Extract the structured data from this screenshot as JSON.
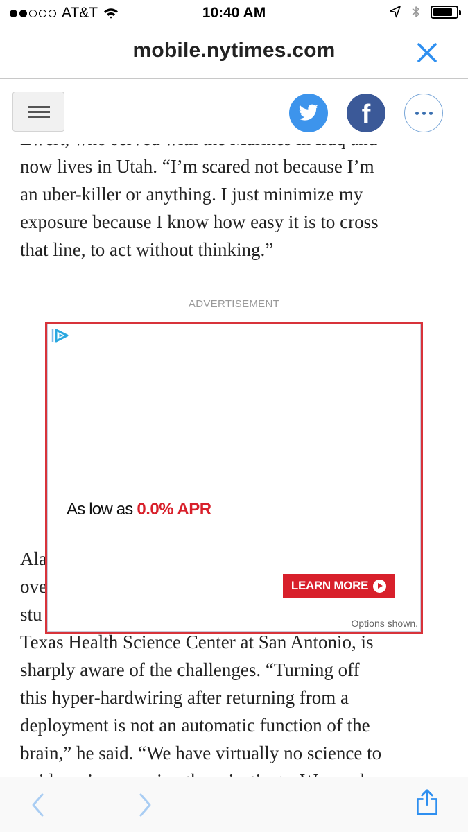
{
  "status_bar": {
    "carrier": "AT&T",
    "time": "10:40 AM",
    "signal_bars_filled": 2,
    "signal_bars_total": 5,
    "battery_level": 0.85
  },
  "browser": {
    "url": "mobile.nytimes.com",
    "close_icon": "close-icon",
    "accent_color": "#2e8ff0"
  },
  "toolbar": {
    "menu_icon": "hamburger-menu-icon",
    "share_buttons": [
      "twitter-icon",
      "facebook-icon",
      "more-icon"
    ],
    "facebook_glyph": "f",
    "twitter_color": "#3d94ec",
    "facebook_color": "#3b5998"
  },
  "article": {
    "top_lines": [
      "Ewert, who served with the Marines in Iraq and",
      "now lives in Utah. “I’m scared not because I’m",
      "an uber-killer or anything. I just minimize my",
      "exposure because I know how easy it is to cross",
      "that line, to act without thinking.”"
    ],
    "bottom_lines": [
      "Ala",
      "ove",
      "stu",
      "Texas Health Science Center at San Antonio, is",
      "sharply aware of the challenges. “Turning off",
      "this hyper-hardwiring after returning from a",
      "deployment is not an automatic function of the",
      "brain,” he said. “We have virtually no science to",
      "guide us in managing these instincts. We need"
    ]
  },
  "advertisement": {
    "label": "ADVERTISEMENT",
    "headline_prefix": "As low as ",
    "headline_highlight": "0.0% APR",
    "button_label": "LEARN MORE",
    "footer": "Options shown.",
    "border_color": "#d8333a",
    "brand_color": "#d8202b",
    "adchoices_icon": "adchoices-icon"
  },
  "bottom_bar": {
    "icons": [
      "back-icon",
      "forward-icon",
      "share-icon"
    ]
  }
}
